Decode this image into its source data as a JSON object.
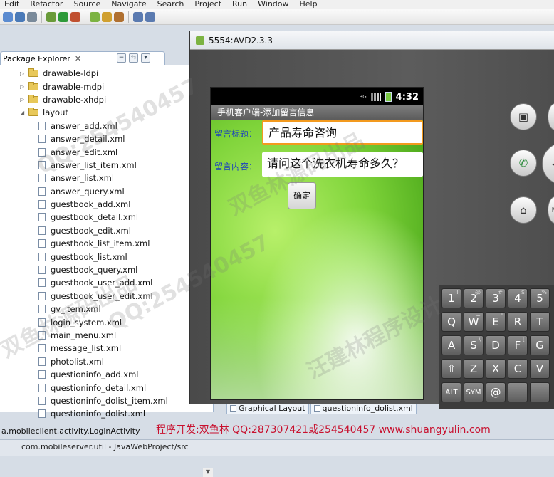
{
  "menu": [
    "Edit",
    "Refactor",
    "Source",
    "Navigate",
    "Search",
    "Project",
    "Run",
    "Window",
    "Help"
  ],
  "toolbar_icons": [
    "new-icon",
    "save-icon",
    "print-icon",
    "debug-icon",
    "run-icon",
    "external-tools-icon",
    "android-sdk-icon",
    "search-icon",
    "open-type-icon",
    "back-icon",
    "forward-icon"
  ],
  "package_explorer": {
    "title": "Package Explorer",
    "close": "✕",
    "items": [
      {
        "label": "drawable-ldpi",
        "type": "folder",
        "depth": 1,
        "expanded": false
      },
      {
        "label": "drawable-mdpi",
        "type": "folder",
        "depth": 1,
        "expanded": false
      },
      {
        "label": "drawable-xhdpi",
        "type": "folder",
        "depth": 1,
        "expanded": false
      },
      {
        "label": "layout",
        "type": "folder",
        "depth": 1,
        "expanded": true
      },
      {
        "label": "answer_add.xml",
        "type": "xml",
        "depth": 2
      },
      {
        "label": "answer_detail.xml",
        "type": "xml",
        "depth": 2
      },
      {
        "label": "answer_edit.xml",
        "type": "xml",
        "depth": 2
      },
      {
        "label": "answer_list_item.xml",
        "type": "xml",
        "depth": 2
      },
      {
        "label": "answer_list.xml",
        "type": "xml",
        "depth": 2
      },
      {
        "label": "answer_query.xml",
        "type": "xml",
        "depth": 2
      },
      {
        "label": "guestbook_add.xml",
        "type": "xml",
        "depth": 2
      },
      {
        "label": "guestbook_detail.xml",
        "type": "xml",
        "depth": 2
      },
      {
        "label": "guestbook_edit.xml",
        "type": "xml",
        "depth": 2
      },
      {
        "label": "guestbook_list_item.xml",
        "type": "xml",
        "depth": 2
      },
      {
        "label": "guestbook_list.xml",
        "type": "xml",
        "depth": 2
      },
      {
        "label": "guestbook_query.xml",
        "type": "xml",
        "depth": 2
      },
      {
        "label": "guestbook_user_add.xml",
        "type": "xml",
        "depth": 2
      },
      {
        "label": "guestbook_user_edit.xml",
        "type": "xml",
        "depth": 2
      },
      {
        "label": "gv_item.xml",
        "type": "xml",
        "depth": 2
      },
      {
        "label": "login_system.xml",
        "type": "xml",
        "depth": 2
      },
      {
        "label": "main_menu.xml",
        "type": "xml",
        "depth": 2
      },
      {
        "label": "message_list.xml",
        "type": "xml",
        "depth": 2
      },
      {
        "label": "photolist.xml",
        "type": "xml",
        "depth": 2
      },
      {
        "label": "questioninfo_add.xml",
        "type": "xml",
        "depth": 2
      },
      {
        "label": "questioninfo_detail.xml",
        "type": "xml",
        "depth": 2
      },
      {
        "label": "questioninfo_dolist_item.xml",
        "type": "xml",
        "depth": 2
      },
      {
        "label": "questioninfo_dolist.xml",
        "type": "xml",
        "depth": 2
      }
    ]
  },
  "editor_tabs": [
    "Graphical Layout",
    "questioninfo_dolist.xml"
  ],
  "status_text": "a.mobileclient.activity.LoginActivity",
  "bottom_text": "com.mobileserver.util - JavaWebProject/src",
  "credit": "程序开发:双鱼林 QQ:287307421或254540457 www.shuangyulin.com",
  "emulator": {
    "title": "5554:AVD2.3.3",
    "status_time": "4:32",
    "network": "3G",
    "app_title": "手机客户端-添加留言信息",
    "form": {
      "title_label": "留言标题：",
      "title_value": "产品寿命咨询",
      "content_label": "留言内容：",
      "content_value": "请问这个洗衣机寿命多久？",
      "submit_label": "确定"
    },
    "hw_buttons": [
      "camera-icon",
      "call-icon",
      "home-icon",
      "menu-icon"
    ],
    "keyboard": [
      {
        "k": "1",
        "s": "!"
      },
      {
        "k": "2",
        "s": "@"
      },
      {
        "k": "3",
        "s": "#"
      },
      {
        "k": "4",
        "s": "$"
      },
      {
        "k": "5",
        "s": "%"
      },
      {
        "k": "Q",
        "s": ""
      },
      {
        "k": "W",
        "s": "~"
      },
      {
        "k": "E",
        "s": "\""
      },
      {
        "k": "R",
        "s": ""
      },
      {
        "k": "T",
        "s": ""
      },
      {
        "k": "A",
        "s": ""
      },
      {
        "k": "S",
        "s": "\\"
      },
      {
        "k": "D",
        "s": ""
      },
      {
        "k": "F",
        "s": "["
      },
      {
        "k": "G",
        "s": ""
      },
      {
        "k": "⇧",
        "s": ""
      },
      {
        "k": "Z",
        "s": ""
      },
      {
        "k": "X",
        "s": ""
      },
      {
        "k": "C",
        "s": ""
      },
      {
        "k": "V",
        "s": ""
      },
      {
        "k": "ALT",
        "s": ""
      },
      {
        "k": "SYM",
        "s": ""
      },
      {
        "k": "@",
        "s": ""
      },
      {
        "k": "",
        "s": ""
      },
      {
        "k": "",
        "s": ""
      }
    ]
  },
  "watermarks": [
    "双鱼林源码出品",
    "QQ:254540457",
    "汪建林程序设计"
  ]
}
